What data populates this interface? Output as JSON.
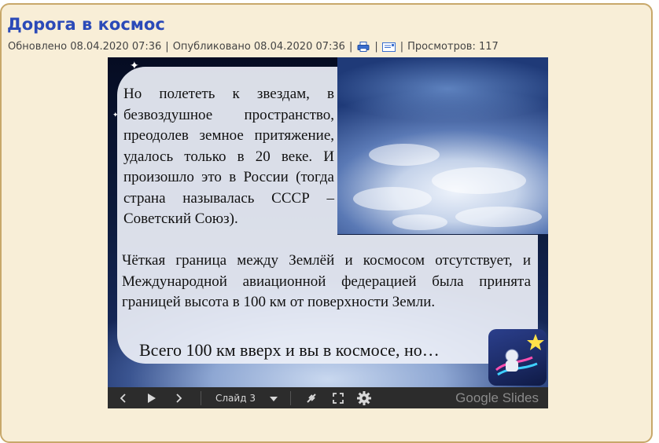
{
  "article": {
    "title": "Дорога в космос",
    "updated": "Обновлено 08.04.2020 07:36",
    "published": "Опубликовано 08.04.2020 07:36",
    "views": "Просмотров: 117",
    "separator": "|"
  },
  "slide": {
    "paragraph_top": "Но полететь к звездам, в безвоздушное пространство, преодолев земное притяжение, удалось только в 20 веке. И произошло это в России (тогда страна называлась СССР – Советский Союз).",
    "paragraph_mid": "Чёткая граница между Землёй и космосом отсутствует, и Международной авиационной федерацией была принята границей высота в 100 км от поверхности Земли.",
    "paragraph_bottom": "Всего 100 км вверх и вы в космосе, но…"
  },
  "controls": {
    "slide_label": "Слайд 3",
    "brand": "Google Slides"
  },
  "icons": {
    "print": "print-icon",
    "email": "email-icon",
    "prev": "chevron-left-icon",
    "play": "play-icon",
    "next": "chevron-right-icon",
    "dropdown": "chevron-down-icon",
    "pointer": "laser-pointer-icon",
    "fullscreen": "fullscreen-icon",
    "settings": "gear-icon"
  },
  "colors": {
    "title": "#2b4ab8",
    "panel_bg": "#f8eed7",
    "panel_border": "#c8a86a",
    "controls_bg": "#2c2c2c"
  }
}
